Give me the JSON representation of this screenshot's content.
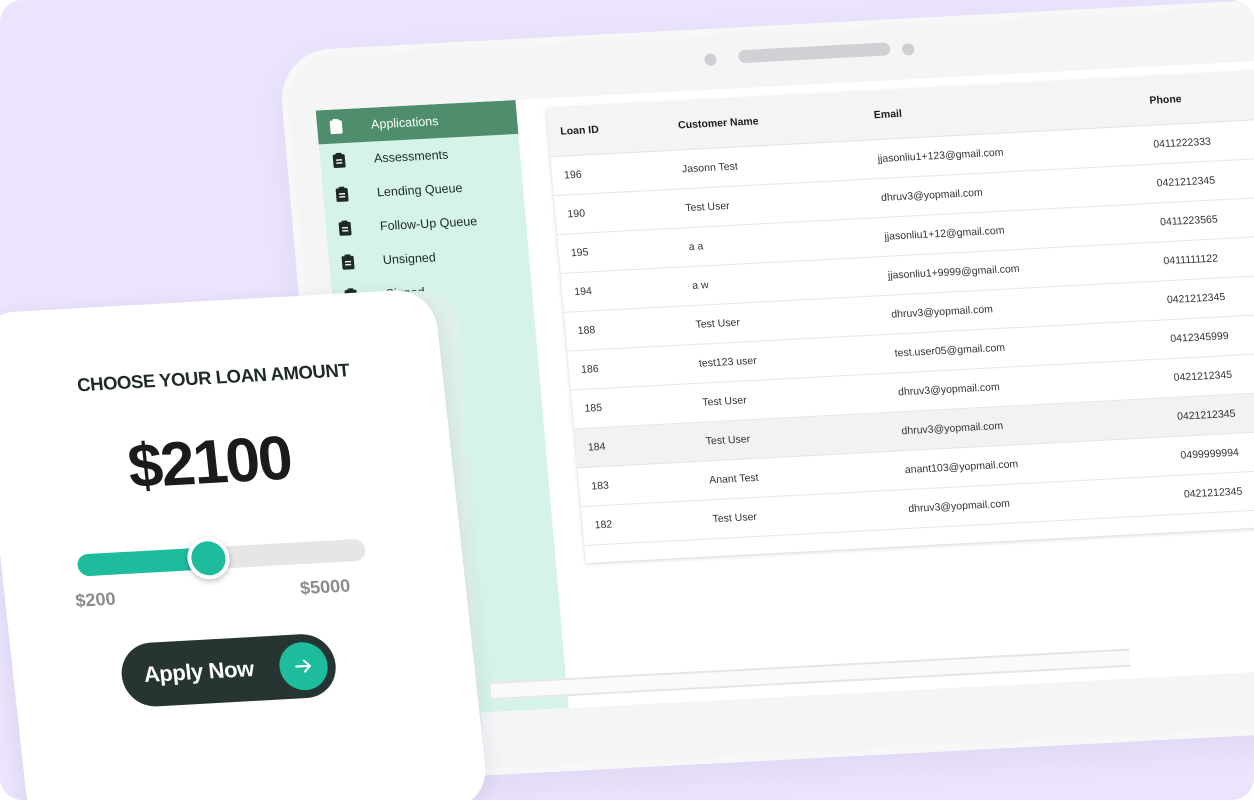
{
  "sidebar": {
    "items": [
      {
        "label": "Applications",
        "icon": "clipboard-icon",
        "active": true
      },
      {
        "label": "Assessments",
        "icon": "clipboard-icon"
      },
      {
        "label": "Lending Queue",
        "icon": "clipboard-icon"
      },
      {
        "label": "Follow-Up Queue",
        "icon": "clipboard-icon"
      },
      {
        "label": "Unsigned",
        "icon": "clipboard-icon"
      },
      {
        "label": "Signed",
        "icon": "clipboard-icon"
      }
    ]
  },
  "table": {
    "columns": [
      "Loan ID",
      "Customer Name",
      "Email",
      "Phone"
    ],
    "rows": [
      [
        "196",
        "Jasonn Test",
        "jjasonliu1+123@gmail.com",
        "0411222333"
      ],
      [
        "190",
        "Test User",
        "dhruv3@yopmail.com",
        "0421212345"
      ],
      [
        "195",
        "a a",
        "jjasonliu1+12@gmail.com",
        "0411223565"
      ],
      [
        "194",
        "a w",
        "jjasonliu1+9999@gmail.com",
        "0411111122"
      ],
      [
        "188",
        "Test User",
        "dhruv3@yopmail.com",
        "0421212345"
      ],
      [
        "186",
        "test123 user",
        "test.user05@gmail.com",
        "0412345999"
      ],
      [
        "185",
        "Test User",
        "dhruv3@yopmail.com",
        "0421212345"
      ],
      [
        "184",
        "Test User",
        "dhruv3@yopmail.com",
        "0421212345"
      ],
      [
        "183",
        "Anant Test",
        "anant103@yopmail.com",
        "0499999994"
      ],
      [
        "182",
        "Test User",
        "dhruv3@yopmail.com",
        "0421212345"
      ]
    ],
    "selected_row": 7
  },
  "loan": {
    "title": "CHOOSE YOUR LOAN AMOUNT",
    "amount": "$2100",
    "value": 2100,
    "min": 200,
    "max": 5000,
    "min_label": "$200",
    "max_label": "$5000",
    "apply_label": "Apply Now"
  },
  "colors": {
    "background": "#ebe4fc",
    "sidebar_bg": "#d5f3e6",
    "sidebar_active": "#4e8e6d",
    "accent": "#1dbc9c",
    "button_dark": "#263532"
  }
}
